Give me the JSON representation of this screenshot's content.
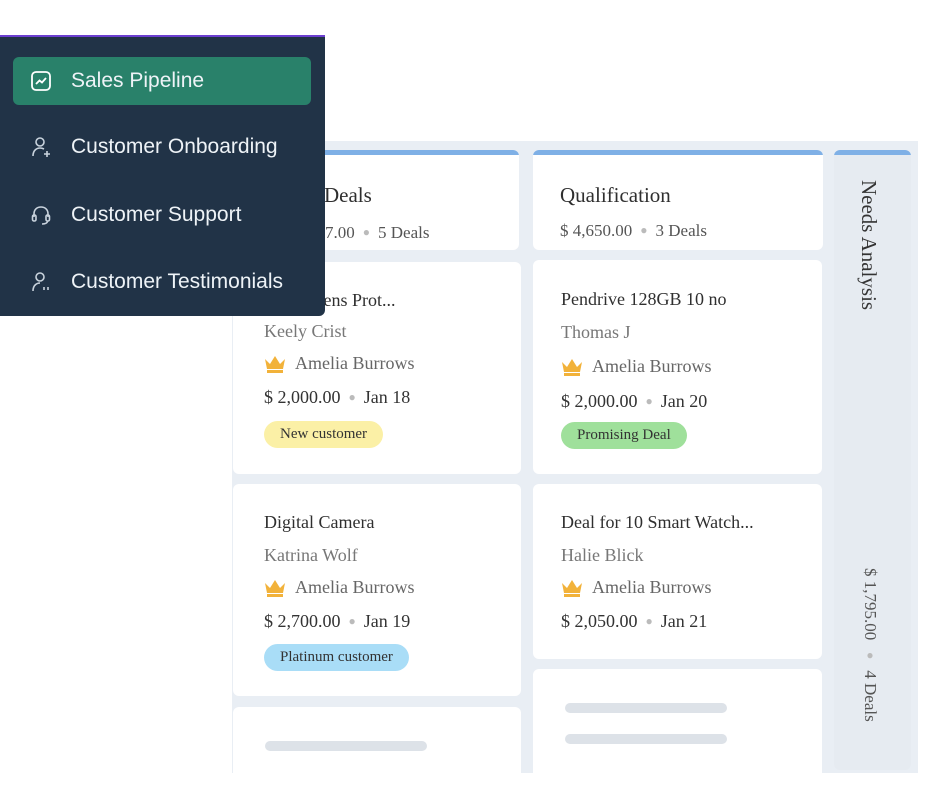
{
  "menu": {
    "items": [
      {
        "label": "Sales Pipeline",
        "icon": "chart-line-icon",
        "active": true
      },
      {
        "label": "Customer Onboarding",
        "icon": "user-add-icon",
        "active": false
      },
      {
        "label": "Customer Support",
        "icon": "headset-icon",
        "active": false
      },
      {
        "label": "Customer Testimonials",
        "icon": "user-quote-icon",
        "active": false
      }
    ]
  },
  "columns": [
    {
      "title": "Deals",
      "amount": "7.00",
      "count": "5 Deals",
      "cards": [
        {
          "title": "amera Lens Prot...",
          "contact": "Keely Crist",
          "owner": "Amelia Burrows",
          "amount": "$ 2,000.00",
          "date": "Jan 18",
          "tag": "New customer",
          "tag_color": "#fbf0a6"
        },
        {
          "title": "Digital Camera",
          "contact": "Katrina Wolf",
          "owner": "Amelia Burrows",
          "amount": "$ 2,700.00",
          "date": "Jan 19",
          "tag": "Platinum customer",
          "tag_color": "#a9ddf7"
        }
      ]
    },
    {
      "title": "Qualification",
      "amount": "$ 4,650.00",
      "count": "3 Deals",
      "cards": [
        {
          "title": "Pendrive 128GB 10 no",
          "contact": "Thomas J",
          "owner": "Amelia Burrows",
          "amount": "$ 2,000.00",
          "date": "Jan 20",
          "tag": "Promising Deal",
          "tag_color": "#9fe09b"
        },
        {
          "title": "Deal for 10 Smart Watch...",
          "contact": "Halie Blick",
          "owner": "Amelia Burrows",
          "amount": "$ 2,050.00",
          "date": "Jan 21",
          "tag": "",
          "tag_color": ""
        }
      ]
    }
  ],
  "collapsed_column": {
    "title": "Needs Analysis",
    "amount": "$ 1,795.00",
    "count": "4 Deals"
  },
  "colors": {
    "accent": "#29816a",
    "menu_bg": "#213347",
    "column_stripe": "#7fb0e6",
    "owner_crown": "#f2b23a"
  }
}
